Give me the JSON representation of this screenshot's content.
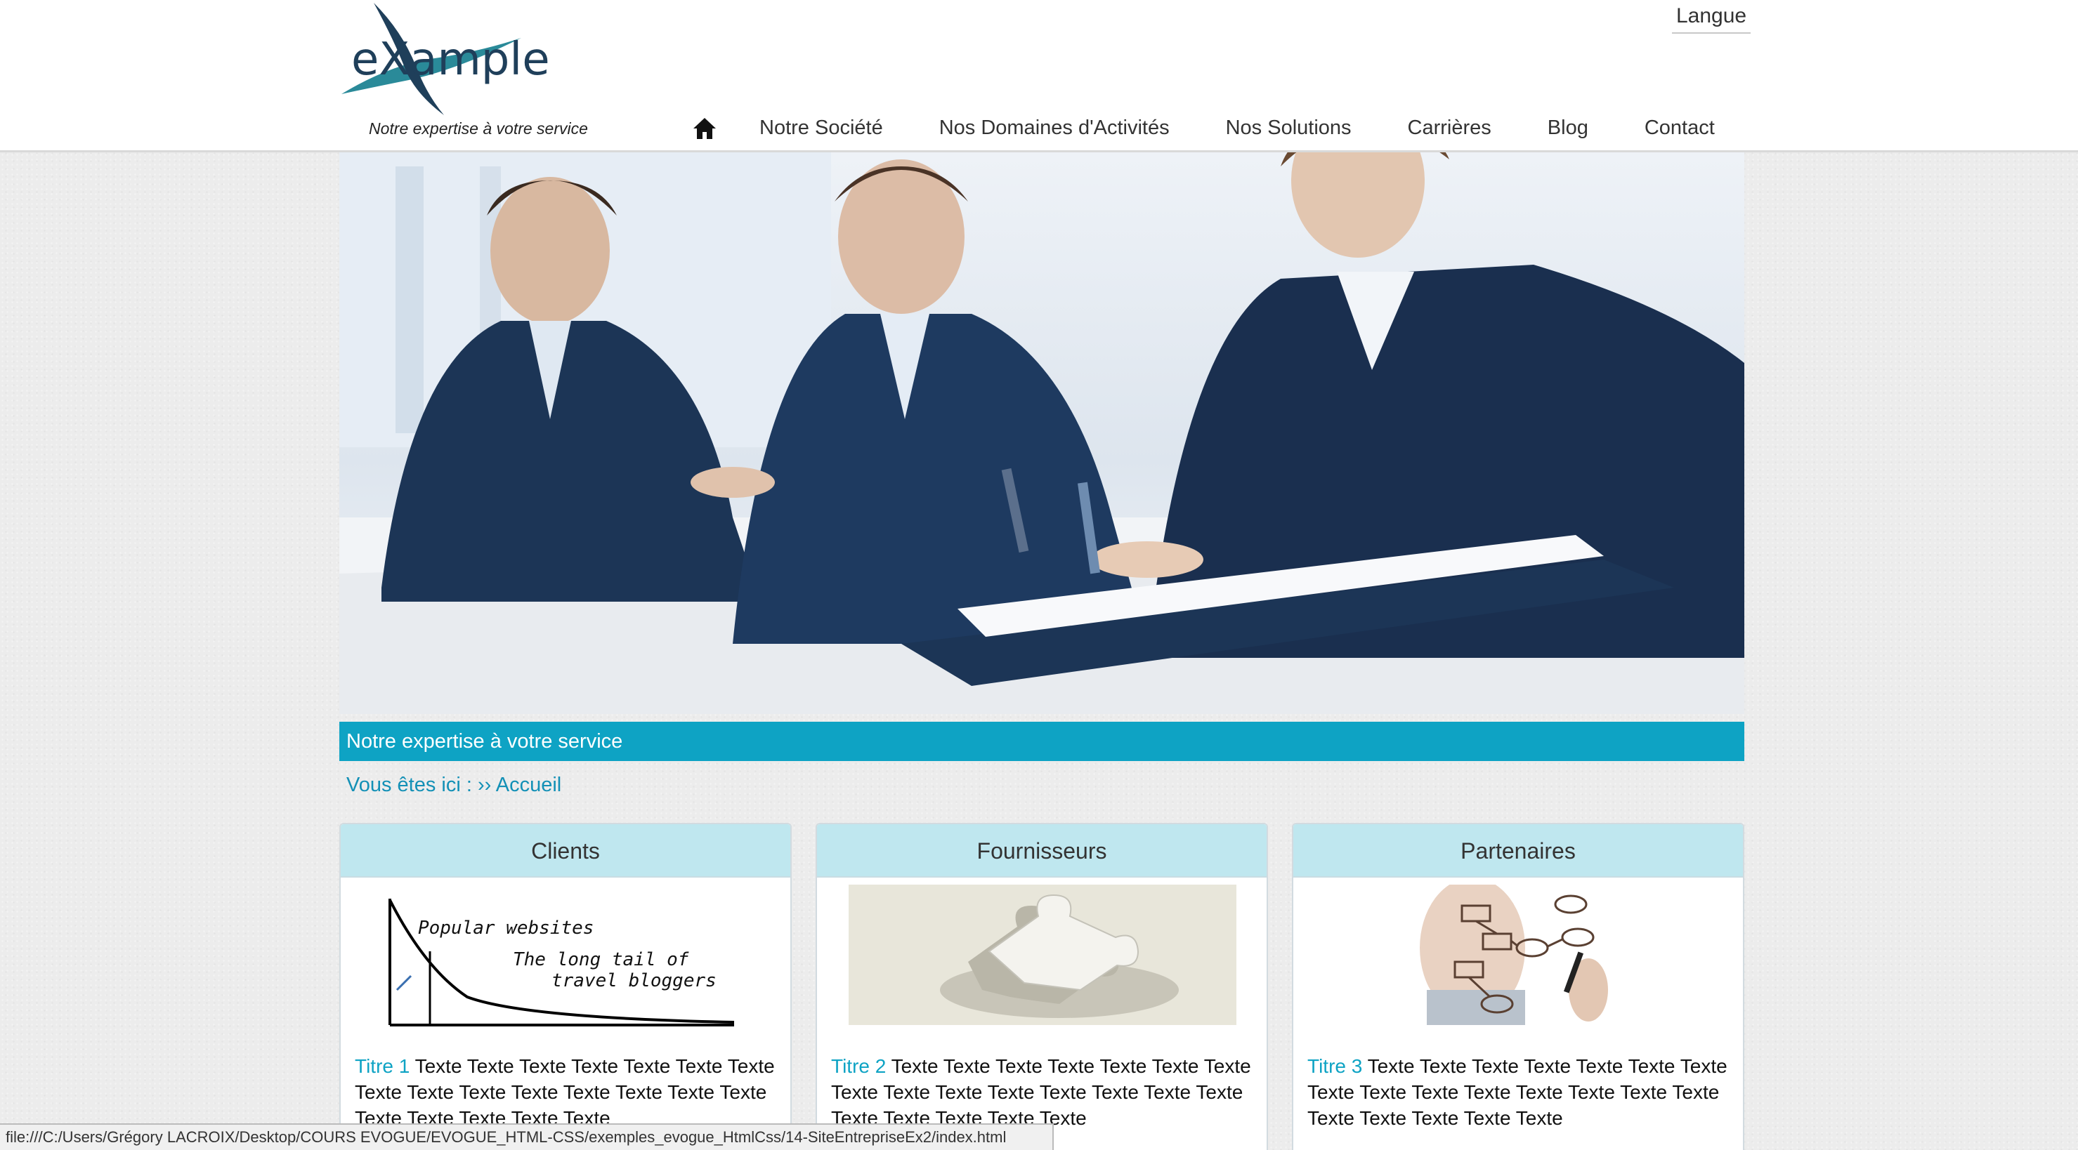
{
  "header": {
    "logo_text": "eXample",
    "tagline": "Notre expertise à votre service",
    "language_label": "Langue"
  },
  "nav": {
    "home_icon": "home-icon",
    "items": [
      "Notre Société",
      "Nos Domaines d'Activités",
      "Nos Solutions",
      "Carrières",
      "Blog",
      "Contact"
    ]
  },
  "hero": {
    "image": "business-meeting-photo"
  },
  "banner": {
    "text": "Notre expertise à votre service"
  },
  "breadcrumb": {
    "text": "Vous êtes ici : ›› Accueil"
  },
  "cards": [
    {
      "heading": "Clients",
      "image": "long-tail-chart-sketch",
      "image_text": [
        "Popular websites",
        "The long tail of",
        "travel bloggers"
      ],
      "title": "Titre 1",
      "body": "Texte Texte Texte Texte Texte Texte Texte Texte Texte Texte Texte Texte Texte Texte Texte Texte Texte Texte Texte Texte"
    },
    {
      "heading": "Fournisseurs",
      "image": "puzzle-piece-photo",
      "title": "Titre 2",
      "body": "Texte Texte Texte Texte Texte Texte Texte Texte Texte Texte Texte Texte Texte Texte Texte Texte Texte Texte Texte Texte"
    },
    {
      "heading": "Partenaires",
      "image": "flowchart-drawing-photo",
      "title": "Titre 3",
      "body": "Texte Texte Texte Texte Texte Texte Texte Texte Texte Texte Texte Texte Texte Texte Texte Texte Texte Texte Texte Texte"
    }
  ],
  "status_bar": {
    "url": "file:///C:/Users/Grégory LACROIX/Desktop/COURS EVOGUE/EVOGUE_HTML-CSS/exemples_evogue_HtmlCss/14-SiteEntrepriseEx2/index.html"
  },
  "colors": {
    "accent": "#0ea3c4",
    "card_header": "#bfe7ef",
    "logo_teal": "#2a8a99",
    "logo_navy": "#1f3f5a"
  }
}
